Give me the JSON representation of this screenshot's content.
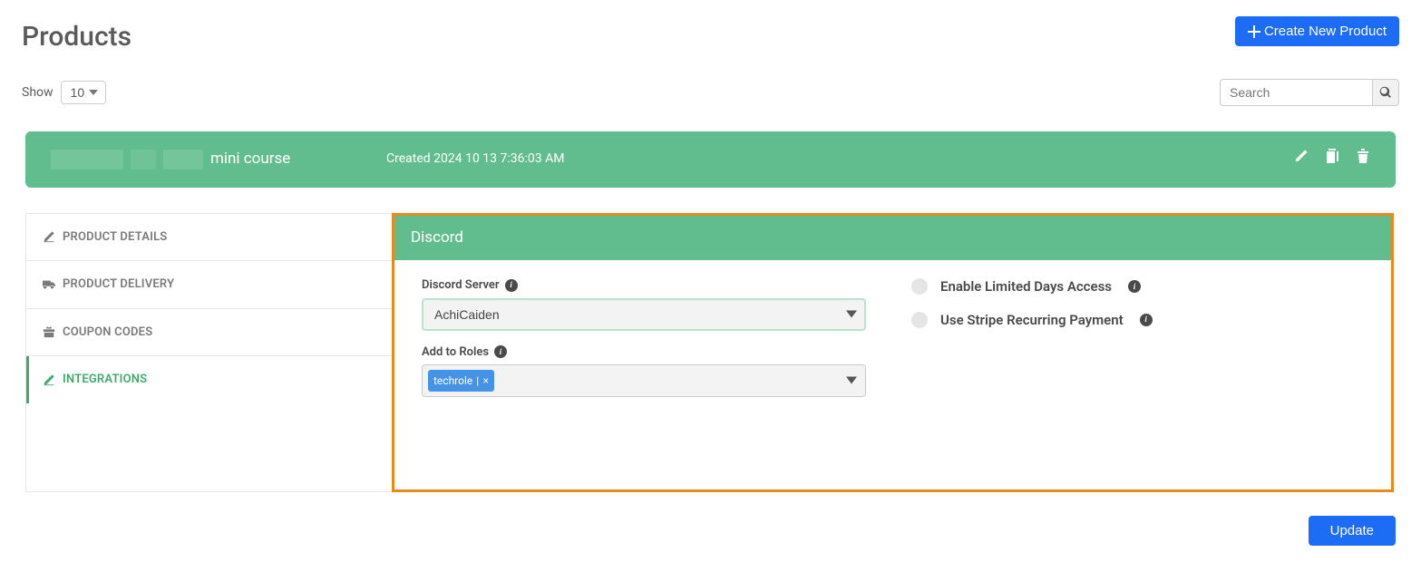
{
  "header": {
    "title": "Products",
    "create_label": "Create New Product"
  },
  "controls": {
    "show_label": "Show",
    "show_value": "10",
    "search_placeholder": "Search"
  },
  "product_card": {
    "title_suffix": "mini course",
    "created_text": "Created 2024 10 13 7:36:03 AM"
  },
  "sidebar": {
    "items": [
      {
        "label": "PRODUCT DETAILS",
        "icon": "edit-icon"
      },
      {
        "label": "PRODUCT DELIVERY",
        "icon": "truck-icon"
      },
      {
        "label": "COUPON CODES",
        "icon": "gift-icon"
      },
      {
        "label": "INTEGRATIONS",
        "icon": "edit-icon"
      }
    ]
  },
  "panel": {
    "title": "Discord",
    "server_label": "Discord Server",
    "server_value": "AchiCaiden",
    "roles_label": "Add to Roles",
    "role_pill": "techrole",
    "limited_label": "Enable Limited Days Access",
    "stripe_label": "Use Stripe Recurring Payment"
  },
  "actions": {
    "update_label": "Update"
  }
}
